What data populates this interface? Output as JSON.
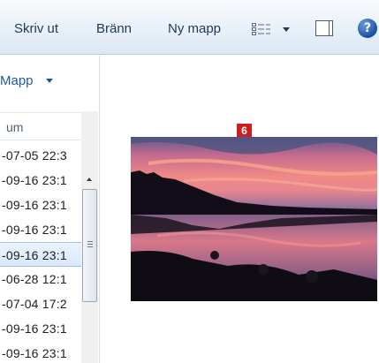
{
  "toolbar": {
    "print_label": "Skriv ut",
    "burn_label": "Bränn",
    "new_folder_label": "Ny mapp",
    "help_glyph": "?"
  },
  "left_pane": {
    "arrange_label": "Mapp",
    "column_header": "um",
    "dates": [
      "-07-05 22:3",
      "-09-16 23:1",
      "-09-16 23:1",
      "-09-16 23:1",
      "-09-16 23:1",
      "-06-28 12:1",
      "-07-04 17:2",
      "-09-16 23:1",
      "-09-16 23:1"
    ],
    "selected_index": 4
  },
  "preview": {
    "badge": "6",
    "image_description": "sunset-lake-photo"
  },
  "colors": {
    "toolbar_text": "#1e395b",
    "link_blue": "#1f5aa8",
    "badge_red": "#cc1f1f",
    "selection": "#d8e9fb"
  },
  "icons": {
    "view": "view-details-icon",
    "view_dropdown": "chevron-down-icon",
    "preview_pane": "preview-pane-icon",
    "help": "help-icon"
  }
}
